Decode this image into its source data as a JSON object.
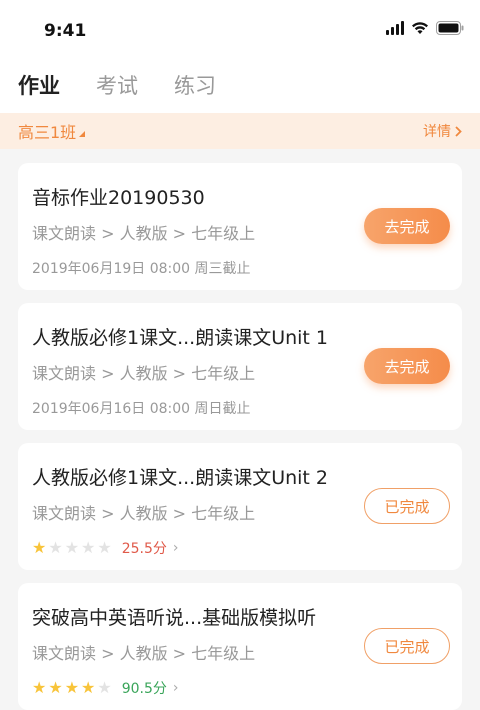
{
  "status_bar": {
    "time": "9:41"
  },
  "tabs": [
    {
      "label": "作业",
      "active": true
    },
    {
      "label": "考试",
      "active": false
    },
    {
      "label": "练习",
      "active": false
    }
  ],
  "class_bar": {
    "class_name": "高三1班",
    "details_label": "详情"
  },
  "colors": {
    "accent": "#f0883e",
    "accent_bg": "#fdeee2",
    "score_red": "#e05a4a",
    "score_green": "#3aa55a"
  },
  "assignments": [
    {
      "title": "音标作业20190530",
      "path": "课文朗读 > 人教版 > 七年级上",
      "deadline": "2019年06月19日 08:00 周三截止",
      "button": "去完成",
      "status": "todo"
    },
    {
      "title": "人教版必修1课文...朗读课文Unit 1",
      "path": "课文朗读 > 人教版 > 七年级上",
      "deadline": "2019年06月16日 08:00 周日截止",
      "button": "去完成",
      "status": "todo"
    },
    {
      "title": "人教版必修1课文...朗读课文Unit 2",
      "path": "课文朗读 > 人教版 > 七年级上",
      "rating": 1,
      "rating_max": 5,
      "score": "25.5分",
      "button": "已完成",
      "status": "done"
    },
    {
      "title": "突破高中英语听说...基础版模拟听",
      "path": "课文朗读 > 人教版 > 七年级上",
      "rating": 4,
      "rating_max": 5,
      "score": "90.5分",
      "button": "已完成",
      "status": "done"
    }
  ]
}
